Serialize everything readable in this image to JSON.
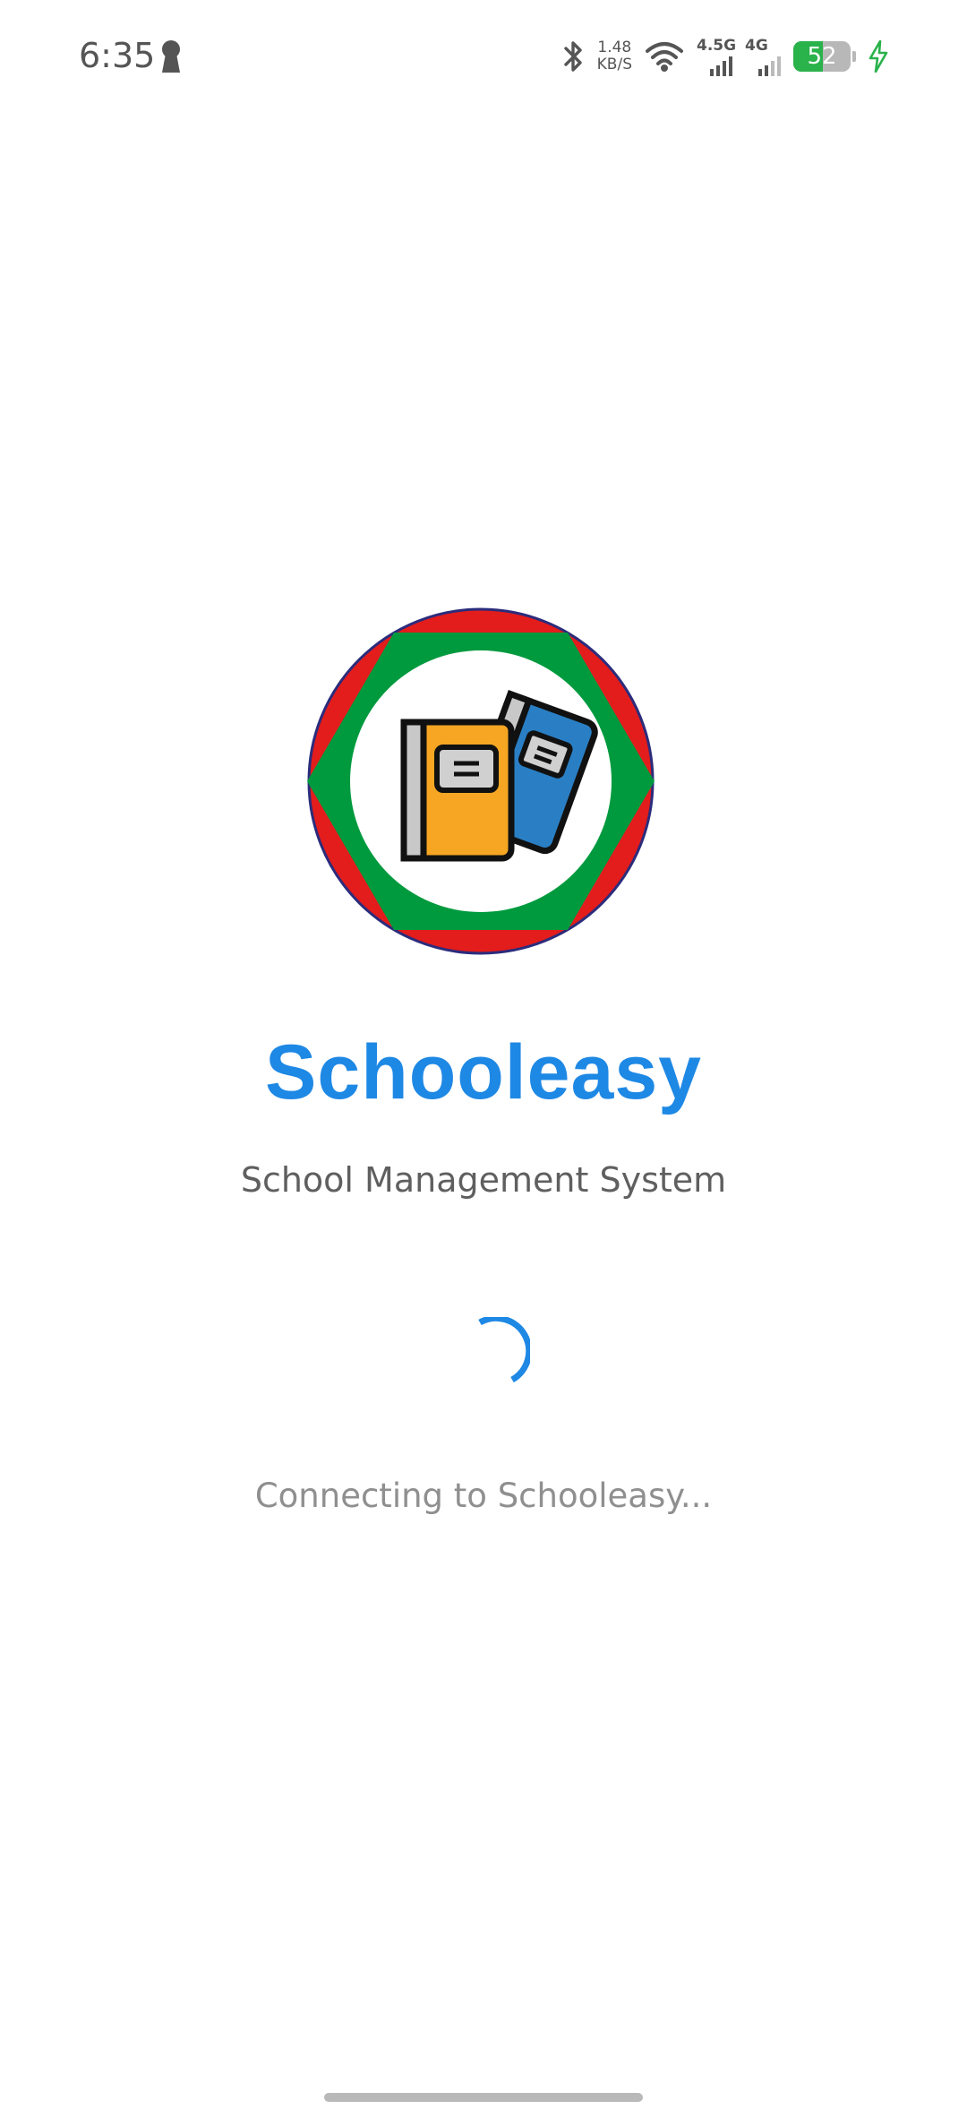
{
  "status_bar": {
    "time": "6:35",
    "net_speed_value": "1.48",
    "net_speed_unit": "KB/S",
    "network_1": "4.5G",
    "network_2": "4G",
    "battery_level": "52",
    "battery_fraction": 0.52,
    "icons": [
      "keyhole-icon",
      "bluetooth-icon",
      "wifi-icon",
      "signal-icon",
      "signal-icon",
      "battery-icon",
      "charging-bolt-icon"
    ]
  },
  "splash": {
    "logo_icon": "books-logo-icon",
    "title": "Schooleasy",
    "subtitle": "School Management System",
    "status": "Connecting to Schooleasy..."
  },
  "colors": {
    "brand_blue": "#1e88e5",
    "logo_red": "#e31c1c",
    "logo_green": "#009a3e",
    "book_orange": "#f6a623",
    "book_blue": "#2a7fc4",
    "battery_green": "#2ab24b"
  }
}
